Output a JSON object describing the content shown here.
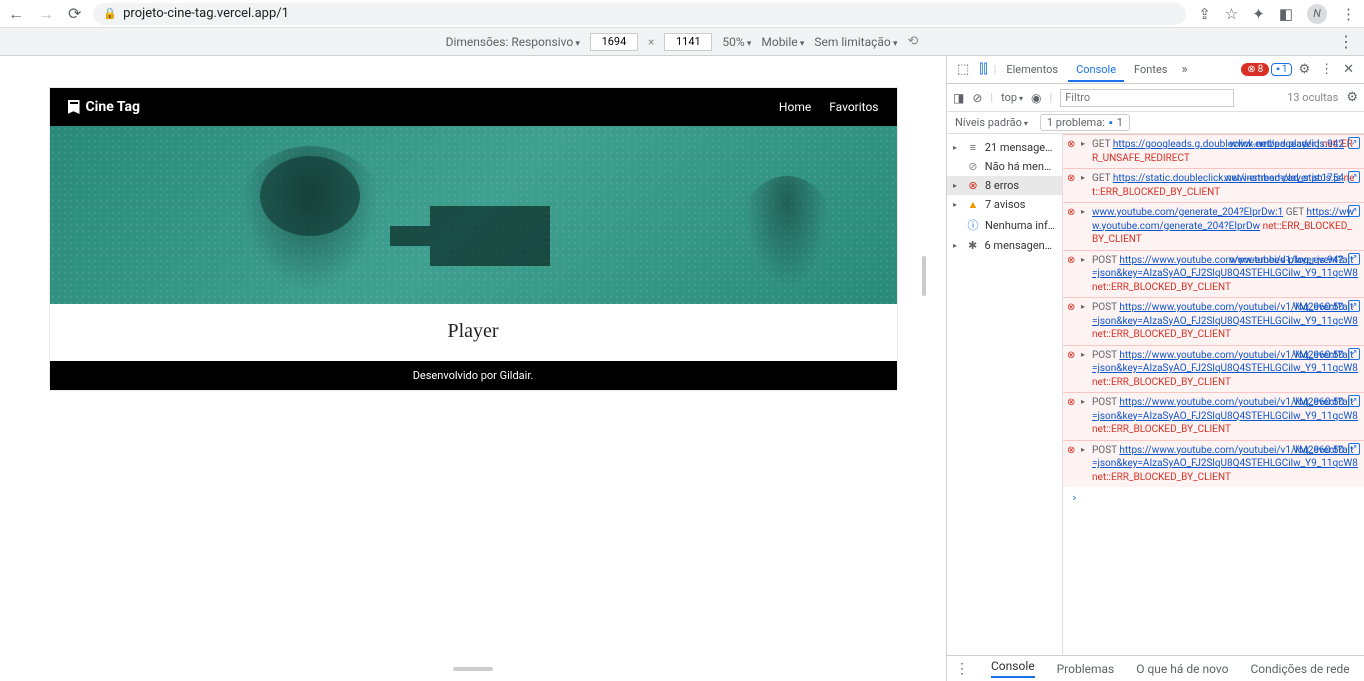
{
  "chrome": {
    "url": "projeto-cine-tag.vercel.app/1",
    "avatar": "N"
  },
  "device_toolbar": {
    "dimensions_label": "Dimensões: Responsivo",
    "width": "1694",
    "height": "1141",
    "zoom": "50%",
    "throttle": "Mobile",
    "no_throttle": "Sem limitação"
  },
  "site": {
    "brand": "Cine Tag",
    "nav_home": "Home",
    "nav_fav": "Favoritos",
    "title": "Player",
    "footer": "Desenvolvido por Gildair."
  },
  "devtools": {
    "tabs": {
      "elements": "Elementos",
      "console": "Console",
      "sources": "Fontes"
    },
    "err_badge": "8",
    "info_badge": "1",
    "filter": {
      "context": "top",
      "placeholder": "Filtro",
      "hidden": "13 ocultas"
    },
    "levels": {
      "default": "Níveis padrão",
      "issues_label": "1 problema:",
      "issues_count": "1"
    },
    "sidebar": [
      {
        "arrow": "▸",
        "icon": "≡",
        "cls": "msg",
        "txt": "21 mensagens"
      },
      {
        "arrow": "",
        "icon": "⊘",
        "cls": "nomsg",
        "txt": "Não há mens…"
      },
      {
        "arrow": "▸",
        "icon": "⊗",
        "cls": "err",
        "txt": "8 erros",
        "sel": true
      },
      {
        "arrow": "▸",
        "icon": "▲",
        "cls": "warn",
        "txt": "7 avisos"
      },
      {
        "arrow": "",
        "icon": "ⓘ",
        "cls": "info",
        "txt": "Nenhuma inf…"
      },
      {
        "arrow": "▸",
        "icon": "✱",
        "cls": "msg",
        "txt": "6 mensagens…"
      }
    ],
    "log": [
      {
        "method": "GET",
        "url": "https://googleads.g.doubleclick.net/pagead/id",
        "err": "net::ERR_UNSAFE_REDIRECT",
        "src": "www-embed-player.js:942"
      },
      {
        "method": "GET",
        "url": "https://static.doubleclick.net/instream/ad_status.js",
        "err": "net::ERR_BLOCKED_BY_CLIENT",
        "src": "www-embed-player.js:1754"
      },
      {
        "method": "GET",
        "url": "https://www.youtube.com/generate_204?EIprDw",
        "pre": "www.youtube.com/generate_204?EIprDw:1",
        "err": "net::ERR_BLOCKED_BY_CLIENT",
        "src": ""
      },
      {
        "method": "POST",
        "url": "https://www.youtube.com/youtubei/v1/log_event?alt=json&key=AIzaSyAO_FJ2SlqU8Q4STEHLGCilw_Y9_11qcW8",
        "err": "net::ERR_BLOCKED_BY_CLIENT",
        "src": "www-embed-player.js:942"
      },
      {
        "method": "POST",
        "url": "https://www.youtube.com/youtubei/v1/log_event?alt=json&key=AIzaSyAO_FJ2SlqU8Q4STEHLGCilw_Y9_11qcW8",
        "err": "net::ERR_BLOCKED_BY_CLIENT",
        "src": "VM2960:50"
      },
      {
        "method": "POST",
        "url": "https://www.youtube.com/youtubei/v1/log_event?alt=json&key=AIzaSyAO_FJ2SlqU8Q4STEHLGCilw_Y9_11qcW8",
        "err": "net::ERR_BLOCKED_BY_CLIENT",
        "src": "VM2960:50"
      },
      {
        "method": "POST",
        "url": "https://www.youtube.com/youtubei/v1/log_event?alt=json&key=AIzaSyAO_FJ2SlqU8Q4STEHLGCilw_Y9_11qcW8",
        "err": "net::ERR_BLOCKED_BY_CLIENT",
        "src": "VM2960:50"
      },
      {
        "method": "POST",
        "url": "https://www.youtube.com/youtubei/v1/log_event?alt=json&key=AIzaSyAO_FJ2SlqU8Q4STEHLGCilw_Y9_11qcW8",
        "err": "net::ERR_BLOCKED_BY_CLIENT",
        "src": "VM2960:50"
      }
    ],
    "drawer": {
      "console": "Console",
      "problems": "Problemas",
      "whatsnew": "O que há de novo",
      "conditions": "Condições de rede"
    }
  }
}
